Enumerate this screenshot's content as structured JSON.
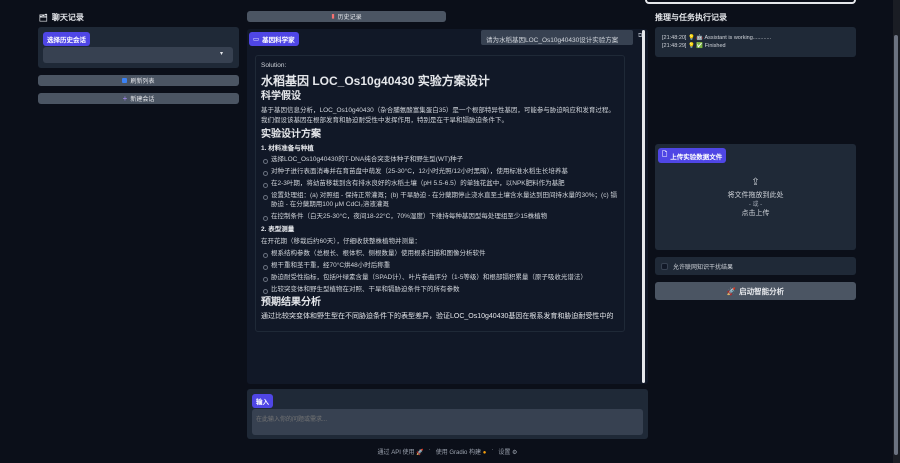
{
  "sidebar": {
    "title": "聊天记录",
    "select_label": "选择历史会话",
    "refresh": "刷新列表",
    "new_chat": "新建会话"
  },
  "center": {
    "history_button": "历史记录",
    "bot_label": "基因科学家",
    "user_message": "请为水稻基因LOC_Os10g40430设计实验方案",
    "answer": {
      "prefix": "Solution:",
      "h1": "水稻基因 LOC_Os10g40430 实验方案设计",
      "h2_hypothesis": "科学假设",
      "hypothesis": "基于基因信息分析，LOC_Os10g40430（杂合脯氨酸富集蛋白35）是一个根部特异性基因，可能参与胁迫响应和发育过程。我们假设该基因在根部发育和胁迫耐受性中发挥作用，特别是在干旱和镉胁迫条件下。",
      "h2_design": "实验设计方案",
      "h4_materials": "1. 材料准备与种植",
      "materials": [
        "选择LOC_Os10g40430的T-DNA纯合突变体种子和野生型(WT)种子",
        "对种子进行表面消毒并在育苗盘中萌发（25-30°C，12小时光照/12小时黑暗），使用标准水稻生长培养基",
        "在2-3叶期，将幼苗移栽到含有排水良好的水稻土壤（pH 5.5-6.5）的单独花盆中，以NPK肥料作为基肥",
        "设置处理组：(a) 对照组 - 保持正常灌溉；(b) 干旱胁迫 - 在分蘖期停止浇水直至土壤含水量达到田间持水量的30%；(c) 镉胁迫 - 在分蘖期用100 μM CdCl₂溶液灌溉",
        "在控制条件（白天25-30°C，夜间18-22°C，70%湿度）下维持每种基因型每处理组至少15株植物"
      ],
      "h4_pheno": "2. 表型测量",
      "pheno_intro": "在开花期（移栽后约60天），仔细收获整株植物并测量：",
      "pheno": [
        "根系结构参数（总根长、根体积、侧根数量）使用根系扫描和图像分析软件",
        "根干重和茎干重，经70°C烘48小时后称重",
        "胁迫耐受性指标，包括叶绿素含量（SPAD计）、叶片卷曲评分（1-5等级）和根部镉积累量（原子吸收光谱法）",
        "比较突变体和野生型植物在对照、干旱和镉胁迫条件下的所有参数"
      ],
      "h2_expected": "预期结果分析",
      "expected": "通过比较突变体和野生型在不同胁迫条件下的表型差异，验证LOC_Os10g40430基因在根系发育和胁迫耐受性中的"
    },
    "input_label": "输入",
    "input_placeholder": "在此输入你的问题或需求..."
  },
  "right": {
    "log_title": "推理与任务执行记录",
    "logs": [
      {
        "time": "[21:48:20]",
        "icon": "💡",
        "emoji": "🤖",
        "text": "Assistant is working............"
      },
      {
        "time": "[21:48:29]",
        "icon": "💡",
        "emoji": "✅",
        "text": "Finished"
      }
    ],
    "upload_label": "上传实验数据文件",
    "drop_text": "将文件拖放到此处",
    "or_text": "- 或 -",
    "click_text": "点击上传",
    "checkbox_label": "允许联网知识干扰结果",
    "checkbox_checked": false,
    "start_button": "启动智能分析"
  },
  "footer": {
    "api": "通过 API 使用",
    "gradio": "使用 Gradio 构建",
    "settings": "设置",
    "sep": "·"
  },
  "colors": {
    "accent": "#4f46e5",
    "bg": "#0b0f19",
    "panel": "#1f2937",
    "button": "#4b5563"
  }
}
